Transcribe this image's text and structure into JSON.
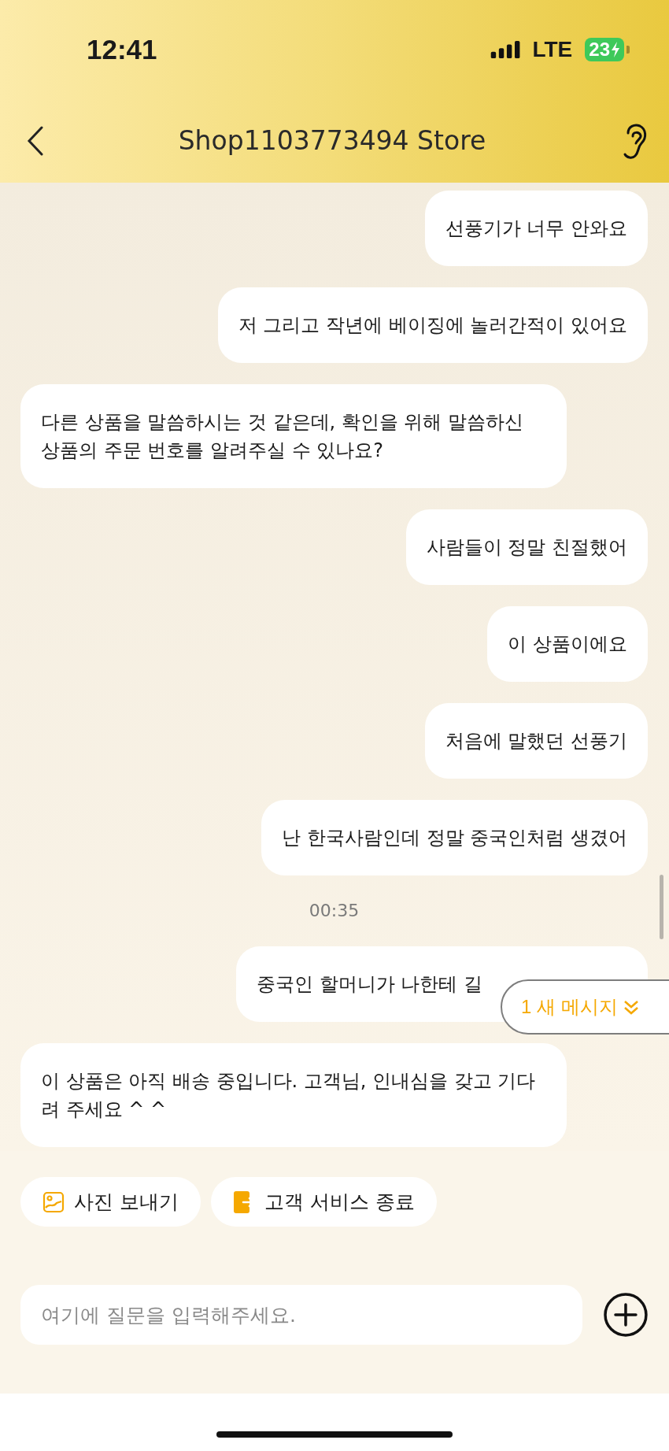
{
  "status_bar": {
    "time": "12:41",
    "network": "LTE",
    "battery": "23"
  },
  "header": {
    "title": "Shop1103773494 Store"
  },
  "messages": [
    {
      "kind": "sent",
      "text": "선풍기가 너무 안와요"
    },
    {
      "kind": "sent",
      "text": "저 그리고 작년에 베이징에 놀러간적이 있어요"
    },
    {
      "kind": "received",
      "text": "다른 상품을 말씀하시는 것 같은데, 확인을 위해 말씀하신 상품의 주문 번호를 알려주실 수 있나요?"
    },
    {
      "kind": "sent",
      "text": "사람들이 정말 친절했어"
    },
    {
      "kind": "sent",
      "text": "이 상품이에요"
    },
    {
      "kind": "sent",
      "text": "처음에 말했던 선풍기"
    },
    {
      "kind": "sent",
      "text": "난 한국사람인데 정말 중국인처럼 생겼어"
    },
    {
      "kind": "time",
      "text": "00:35"
    },
    {
      "kind": "sent_covered",
      "text": "중국인 할머니가 나한테 길"
    },
    {
      "kind": "received",
      "text": "이 상품은 아직 배송 중입니다. 고객님, 인내심을 갖고 기다려 주세요 ^ ^"
    }
  ],
  "new_messages_badge": "1 새 메시지",
  "quick_actions": [
    {
      "kind": "photo",
      "label": "사진 보내기"
    },
    {
      "kind": "end",
      "label": "고객 서비스 종료"
    }
  ],
  "input": {
    "placeholder": "여기에 질문을 입력해주세요."
  }
}
